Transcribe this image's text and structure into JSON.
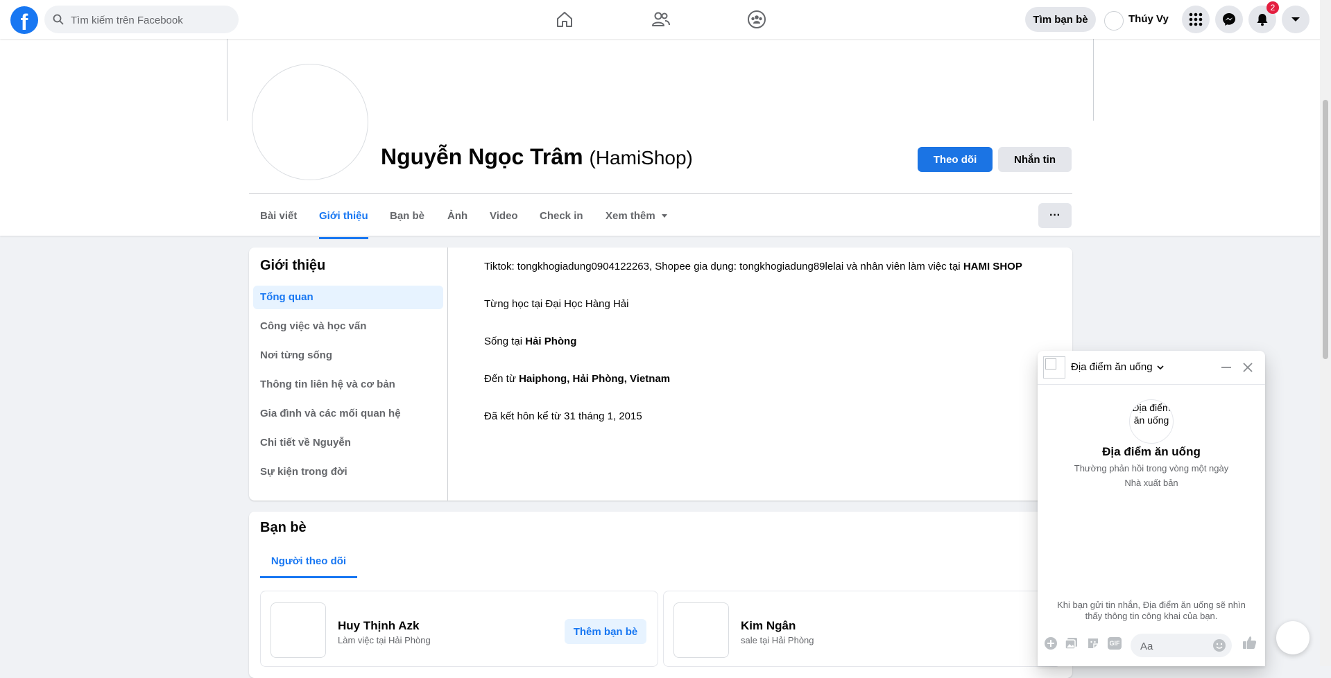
{
  "topbar": {
    "logo": "f",
    "search_placeholder": "Tìm kiếm trên Facebook",
    "find_friends": "Tìm bạn bè",
    "user_name": "Thúy Vy",
    "notification_count": "2"
  },
  "profile": {
    "name": "Nguyễn Ngọc Trâm",
    "alt_name": "(HamiShop)",
    "follow_button": "Theo dõi",
    "message_button": "Nhắn tin",
    "more_button": "···"
  },
  "tabs": [
    "Bài viết",
    "Giới thiệu",
    "Bạn bè",
    "Ảnh",
    "Video",
    "Check in",
    "Xem thêm"
  ],
  "about": {
    "title": "Giới thiệu",
    "menu": [
      "Tổng quan",
      "Công việc và học vấn",
      "Nơi từng sống",
      "Thông tin liên hệ và cơ bản",
      "Gia đình và các mối quan hệ",
      "Chi tiết về Nguyễn",
      "Sự kiện trong đời"
    ],
    "rows": [
      {
        "prefix": "Tiktok: tongkhogiadung0904122263, Shopee gia dụng: tongkhogiadung89lelai và nhân viên làm việc tại ",
        "bold": "HAMI SHOP"
      },
      {
        "prefix": "Từng học tại Đại Học Hàng Hải",
        "bold": ""
      },
      {
        "prefix": "Sống tại ",
        "bold": "Hải Phòng"
      },
      {
        "prefix": "Đến từ ",
        "bold": "Haiphong, Hải Phòng, Vietnam"
      },
      {
        "prefix": "Đã kết hôn kể từ 31 tháng 1, 2015",
        "bold": ""
      }
    ]
  },
  "friends": {
    "title": "Bạn bè",
    "tab": "Người theo dõi",
    "list": [
      {
        "name": "Huy Thịnh Azk",
        "subtitle": "Làm việc tại Hải Phòng",
        "action": "Thêm bạn bè"
      },
      {
        "name": "Kim Ngân",
        "subtitle": "sale tại Hải Phòng",
        "action": ""
      }
    ]
  },
  "chat": {
    "title": "Địa điểm ăn uống",
    "avatar_alt": "Địa điểm ăn uống",
    "name": "Địa điểm ăn uống",
    "response": "Thường phản hồi trong vòng một ngày",
    "role": "Nhà xuất bản",
    "note": "Khi bạn gửi tin nhắn, Địa điểm ăn uống sẽ nhìn thấy thông tin công khai của bạn.",
    "input_placeholder": "Aa",
    "gif_label": "GIF"
  }
}
